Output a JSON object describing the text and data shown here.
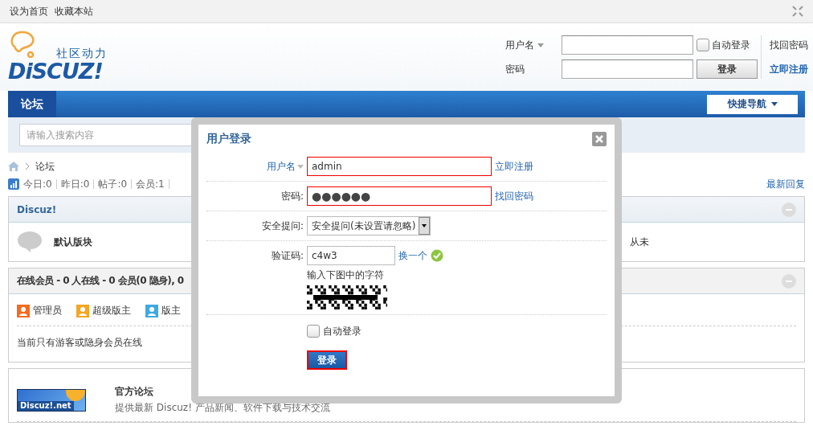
{
  "topbar": {
    "links": [
      "设为首页",
      "收藏本站"
    ]
  },
  "logo": {
    "tagline": "社区动力",
    "wordmark": "DiSCUZ!"
  },
  "header_login": {
    "username_label": "用户名",
    "password_label": "密码",
    "auto_login": {
      "label": "自动登录",
      "checked": false
    },
    "login_button": "登录",
    "links": [
      "找回密码",
      "立即注册"
    ]
  },
  "nav": {
    "tabs": [
      {
        "label": "论坛",
        "selected": true
      }
    ],
    "quick_nav": "快捷导航"
  },
  "search": {
    "placeholder": "请输入搜索内容"
  },
  "breadcrumb": [
    "论坛"
  ],
  "stats": [
    "今日:0",
    "昨日:0",
    "帖子:0",
    "会员:1"
  ],
  "latest_replies": "最新回复",
  "category": {
    "title": "Discuz!",
    "forums": [
      {
        "name": "默认版块",
        "last_post": "从未"
      }
    ]
  },
  "online": {
    "title": "在线会员 - 0 人在线 - 0 会员(0 隐身), 0",
    "legend": [
      {
        "label": "管理员",
        "color": "#f26c21"
      },
      {
        "label": "超级版主",
        "color": "#f5a623"
      },
      {
        "label": "版主",
        "color": "#3fa9e0"
      }
    ],
    "note": "当前只有游客或隐身会员在线"
  },
  "links_box": {
    "sites": [
      {
        "name": "官方论坛",
        "description": "提供最新 Discuz! 产品新闻、软件下载与技术交流",
        "logo_text": "Discuz!.net"
      }
    ]
  },
  "login_dialog": {
    "title": "用户登录",
    "fields": [
      {
        "kind": "text",
        "label": "用户名",
        "value": "admin",
        "link": "立即注册",
        "highlighted": true
      },
      {
        "kind": "password",
        "label": "密码:",
        "value": "●●●●●●",
        "link": "找回密码",
        "highlighted": true
      },
      {
        "kind": "select",
        "label": "安全提问:",
        "value": "安全提问(未设置请忽略)",
        "highlighted": false
      },
      {
        "kind": "captcha",
        "label": "验证码:",
        "value": "c4w3",
        "link": "换一个",
        "hint": "输入下图中的字符",
        "highlighted": false
      }
    ],
    "auto_login": {
      "label": "自动登录",
      "checked": false
    },
    "submit": {
      "label": "登录",
      "highlighted": true
    }
  }
}
